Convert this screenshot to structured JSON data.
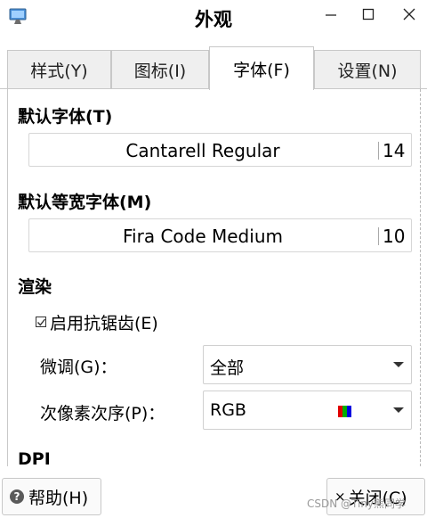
{
  "window": {
    "title": "外观"
  },
  "tabs": [
    {
      "label": "样式(Y)",
      "active": false
    },
    {
      "label": "图标(I)",
      "active": false
    },
    {
      "label": "字体(F)",
      "active": true
    },
    {
      "label": "设置(N)",
      "active": false
    }
  ],
  "fonts": {
    "default_heading": "默认字体(T)",
    "default_font_name": "Cantarell Regular",
    "default_font_size": "14",
    "mono_heading": "默认等宽字体(M)",
    "mono_font_name": "Fira Code Medium",
    "mono_font_size": "10"
  },
  "rendering": {
    "heading": "渲染",
    "antialias_label": "启用抗锯齿(E)",
    "antialias_checked": true,
    "hinting_label": "微调(G)：",
    "hinting_value": "全部",
    "subpixel_label": "次像素次序(P)：",
    "subpixel_value": "RGB"
  },
  "dpi": {
    "heading": "DPI"
  },
  "buttons": {
    "help": "帮助(H)",
    "close": "关闭(C)"
  },
  "watermark": "CSDN @Tiny熊同学"
}
